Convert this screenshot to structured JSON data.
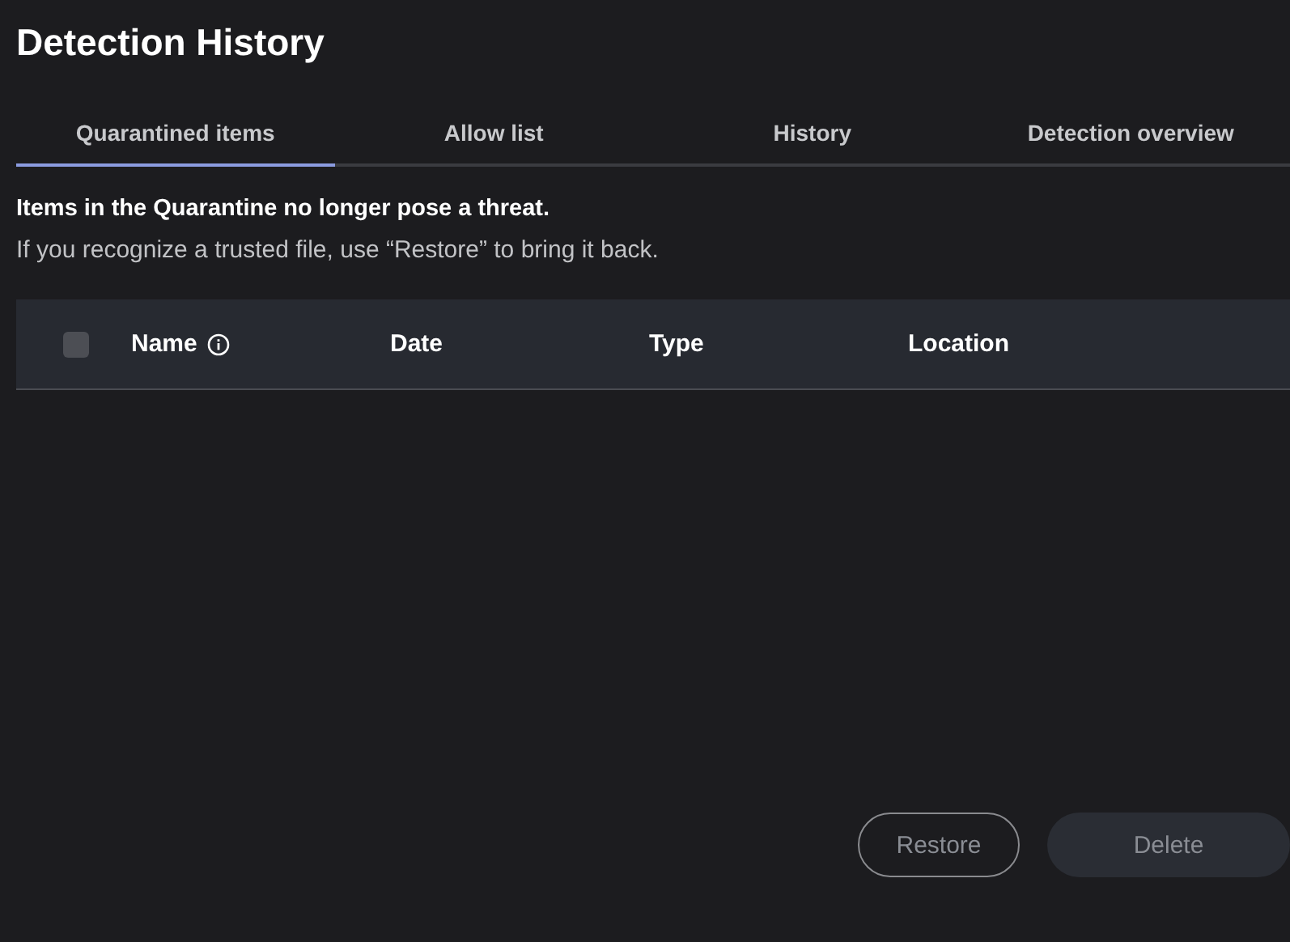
{
  "title": "Detection History",
  "tabs": [
    {
      "label": "Quarantined items",
      "selected": true
    },
    {
      "label": "Allow list",
      "selected": false
    },
    {
      "label": "History",
      "selected": false
    },
    {
      "label": "Detection overview",
      "selected": false
    }
  ],
  "intro": {
    "heading": "Items in the Quarantine no longer pose a threat.",
    "text": "If you recognize a trusted file, use “Restore” to bring it back."
  },
  "table": {
    "select_all": {
      "checked": false
    },
    "columns": [
      {
        "label": "Name",
        "kind": "info"
      },
      {
        "label": "Date",
        "kind": "plain"
      },
      {
        "label": "Type",
        "kind": "plain"
      },
      {
        "label": "Location",
        "kind": "plain"
      }
    ]
  },
  "buttons": [
    {
      "label": "Restore",
      "kind": "outline",
      "disabled": true
    },
    {
      "label": "Delete",
      "kind": "filled",
      "disabled": true
    }
  ]
}
